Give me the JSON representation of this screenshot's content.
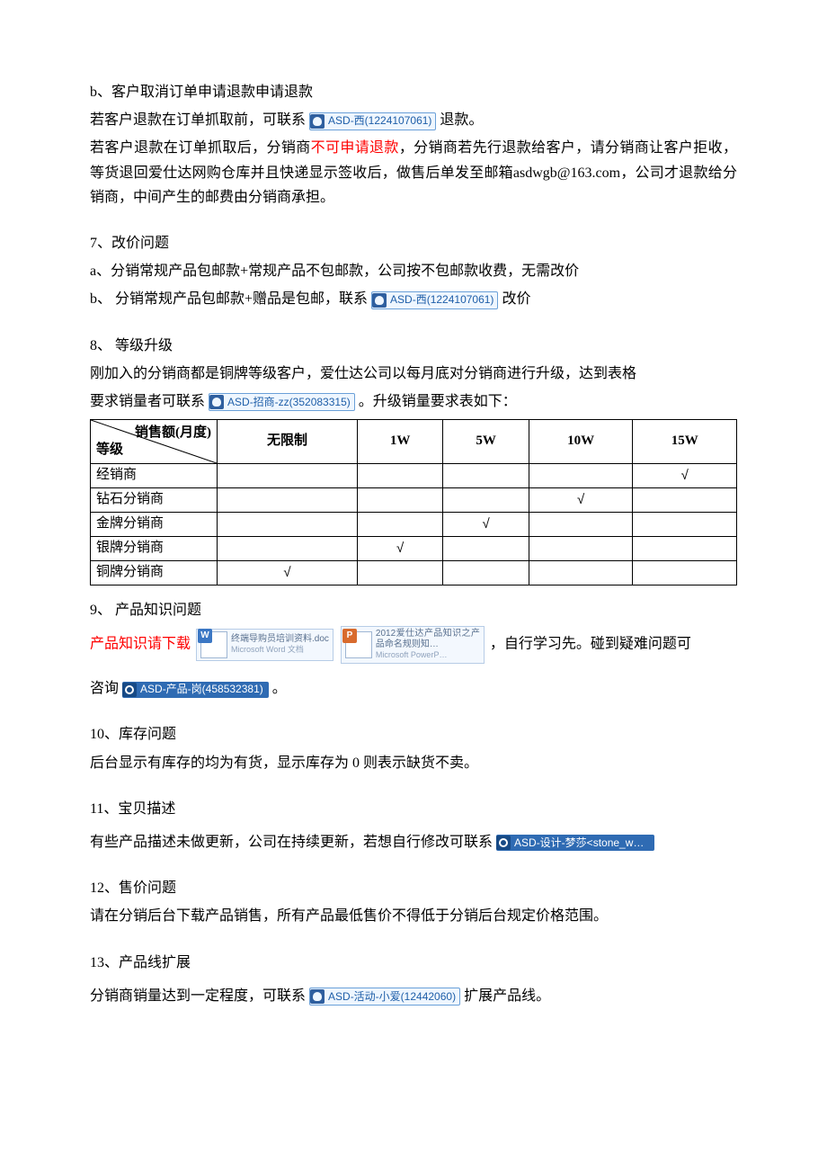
{
  "section_b": {
    "title": "b、客户取消订单申请退款申请退款",
    "line1_a": "若客户退款在订单抓取前，可联系",
    "qq1": "ASD-西(1224107061)",
    "line1_b": "退款。",
    "line2_a": "若客户退款在订单抓取后，分销商",
    "line2_red": "不可申请退款",
    "line2_b": "，分销商若先行退款给客户，请分销商让客户拒收，等货退回爱仕达网购仓库并且快递显示签收后，做售后单发至邮箱asdwgb@163.com，公司才退款给分销商，中间产生的邮费由分销商承担。"
  },
  "section_7": {
    "title": "7、改价问题",
    "a": "a、分销常规产品包邮款+常规产品不包邮款，公司按不包邮款收费，无需改价",
    "b_pre": "b、 分销常规产品包邮款+赠品是包邮，联系",
    "qq": "ASD-西(1224107061)",
    "b_post": "改价"
  },
  "section_8": {
    "title": "8、 等级升级",
    "line1": "刚加入的分销商都是铜牌等级客户，爱仕达公司以每月底对分销商进行升级，达到表格",
    "line2_pre": "要求销量者可联系",
    "qq": "ASD-招商-zz(352083315)",
    "line2_post": "。升级销量要求表如下：",
    "table": {
      "header_diag_top": "销售额(月度)",
      "header_diag_bottom": "等级",
      "cols": [
        "无限制",
        "1W",
        "5W",
        "10W",
        "15W"
      ],
      "rows": [
        {
          "label": "经销商",
          "ticks": [
            "",
            "",
            "",
            "",
            "√"
          ]
        },
        {
          "label": "钻石分销商",
          "ticks": [
            "",
            "",
            "",
            "√",
            ""
          ]
        },
        {
          "label": "金牌分销商",
          "ticks": [
            "",
            "",
            "√",
            "",
            ""
          ]
        },
        {
          "label": "银牌分销商",
          "ticks": [
            "",
            "√",
            "",
            "",
            ""
          ]
        },
        {
          "label": "铜牌分销商",
          "ticks": [
            "√",
            "",
            "",
            "",
            ""
          ]
        }
      ]
    }
  },
  "section_9": {
    "title": "9、 产品知识问题",
    "lead_red": "产品知识请下载",
    "file1_name": "终端导购员培训资料.doc",
    "file1_sub": "Microsoft Word 文档",
    "file2_name": "2012爱仕达产品知识之产品命名规则知…",
    "file2_sub": "Microsoft PowerP…",
    "mid": "，自行学习先。碰到疑难问题可",
    "ask_pre": "咨询",
    "qq": "ASD-产品-岗(458532381)",
    "ask_post": "。"
  },
  "section_10": {
    "title": "10、库存问题",
    "body": "后台显示有库存的均为有货，显示库存为 0 则表示缺货不卖。"
  },
  "section_11": {
    "title": "11、宝贝描述",
    "body_pre": "有些产品描述未做更新，公司在持续更新，若想自行修改可联系",
    "qq": "ASD-设计-梦莎<stone_w…"
  },
  "section_12": {
    "title": "12、售价问题",
    "body": "请在分销后台下载产品销售，所有产品最低售价不得低于分销后台规定价格范围。"
  },
  "section_13": {
    "title": "13、产品线扩展",
    "body_pre": "分销商销量达到一定程度，可联系",
    "qq": "ASD-活动-小爱(12442060)",
    "body_post": "扩展产品线。"
  }
}
